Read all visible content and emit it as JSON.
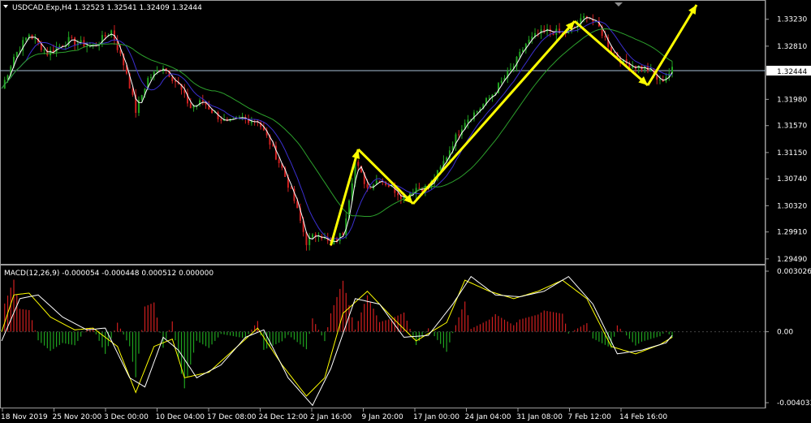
{
  "header": {
    "symbol_line": "USDCAD.Exp,H4  1.32523 1.32541 1.32409 1.32444",
    "dropdown_icon": "triangle-down-icon"
  },
  "colors": {
    "background": "#000000",
    "bull_candle": "#1fa31f",
    "bear_candle": "#d01f1f",
    "fast_ma": "#ffffff",
    "mid_ma": "#3b2fd0",
    "slow_ma": "#2ca02c",
    "arrows": "#ffff00",
    "macd_signal": "#ffff00",
    "macd_line": "#ffffff",
    "price_line": "#a9c1d6"
  },
  "chart_data": [
    {
      "type": "candlestick",
      "panel": "price",
      "title": "USDCAD.Exp,H4  1.32523 1.32541 1.32409 1.32444",
      "y_axis_ticks": [
        "1.33230",
        "1.32810",
        "1.32444",
        "1.31980",
        "1.31570",
        "1.31150",
        "1.30740",
        "1.30320",
        "1.29910",
        "1.29490"
      ],
      "ylim": [
        1.2945,
        1.3348
      ],
      "current_price": "1.32444",
      "x_axis_ticks": [
        "18 Nov 2019",
        "25 Nov 20:00",
        "3 Dec 00:00",
        "10 Dec 04:00",
        "17 Dec 08:00",
        "24 Dec 12:00",
        "2 Jan 16:00",
        "9 Jan 20:00",
        "17 Jan 00:00",
        "24 Jan 04:00",
        "31 Jan 08:00",
        "7 Feb 12:00",
        "14 Feb 16:00"
      ],
      "close_path": [
        [
          0,
          1.3215
        ],
        [
          4,
          1.3265
        ],
        [
          9,
          1.33
        ],
        [
          15,
          1.327
        ],
        [
          22,
          1.329
        ],
        [
          30,
          1.328
        ],
        [
          36,
          1.3305
        ],
        [
          41,
          1.324
        ],
        [
          44,
          1.318
        ],
        [
          48,
          1.323
        ],
        [
          53,
          1.325
        ],
        [
          58,
          1.322
        ],
        [
          62,
          1.3185
        ],
        [
          66,
          1.3195
        ],
        [
          70,
          1.3175
        ],
        [
          74,
          1.316
        ],
        [
          79,
          1.3168
        ],
        [
          84,
          1.3165
        ],
        [
          88,
          1.313
        ],
        [
          92,
          1.309
        ],
        [
          96,
          1.304
        ],
        [
          100,
          1.2975
        ],
        [
          104,
          1.299
        ],
        [
          108,
          1.297
        ],
        [
          112,
          1.299
        ],
        [
          116,
          1.31
        ],
        [
          120,
          1.306
        ],
        [
          124,
          1.3075
        ],
        [
          128,
          1.306
        ],
        [
          132,
          1.3045
        ],
        [
          136,
          1.306
        ],
        [
          140,
          1.306
        ],
        [
          144,
          1.309
        ],
        [
          148,
          1.313
        ],
        [
          152,
          1.3165
        ],
        [
          156,
          1.318
        ],
        [
          160,
          1.32
        ],
        [
          164,
          1.3225
        ],
        [
          168,
          1.325
        ],
        [
          172,
          1.3285
        ],
        [
          176,
          1.33
        ],
        [
          180,
          1.3305
        ],
        [
          184,
          1.33
        ],
        [
          188,
          1.331
        ],
        [
          192,
          1.333
        ],
        [
          196,
          1.331
        ],
        [
          200,
          1.3275
        ],
        [
          204,
          1.3255
        ],
        [
          208,
          1.325
        ],
        [
          212,
          1.3245
        ],
        [
          216,
          1.3225
        ],
        [
          220,
          1.3244
        ]
      ],
      "moving_averages": [
        "fast",
        "mid",
        "slow"
      ],
      "annotations": {
        "type": "zigzag-arrows",
        "points": [
          [
            108,
            1.297
          ],
          [
            117,
            1.312
          ],
          [
            135,
            1.3035
          ],
          [
            188,
            1.332
          ],
          [
            212,
            1.322
          ],
          [
            228,
            1.335
          ]
        ]
      }
    },
    {
      "type": "histogram+lines",
      "panel": "macd",
      "title": "MACD(12,26,9) -0.000054 -0.000448 0.000512 0.000000",
      "y_axis_ticks": [
        "0.003026",
        "0.00",
        "-0.004033"
      ],
      "ylim": [
        -0.004033,
        0.003026
      ],
      "series": [
        {
          "name": "MACD",
          "color": "macd_signal",
          "values": [
            [
              0,
              0
            ],
            [
              4,
              0.002
            ],
            [
              9,
              0.0021
            ],
            [
              16,
              0.0008
            ],
            [
              24,
              0.0001
            ],
            [
              30,
              0.0002
            ],
            [
              38,
              -0.0008
            ],
            [
              44,
              -0.0033
            ],
            [
              50,
              -0.0008
            ],
            [
              56,
              -0.0004
            ],
            [
              60,
              -0.0025
            ],
            [
              68,
              -0.0022
            ],
            [
              76,
              -0.001
            ],
            [
              84,
              0.0002
            ],
            [
              92,
              -0.0018
            ],
            [
              100,
              -0.0035
            ],
            [
              106,
              -0.0025
            ],
            [
              112,
              0.001
            ],
            [
              120,
              0.0022
            ],
            [
              128,
              0.0008
            ],
            [
              136,
              -0.0005
            ],
            [
              146,
              0.0005
            ],
            [
              152,
              0.0028
            ],
            [
              160,
              0.0022
            ],
            [
              168,
              0.0018
            ],
            [
              176,
              0.0022
            ],
            [
              184,
              0.0028
            ],
            [
              192,
              0.0018
            ],
            [
              200,
              -0.0008
            ],
            [
              208,
              -0.0012
            ],
            [
              216,
              -0.0007
            ],
            [
              220,
              -0.0003
            ]
          ]
        },
        {
          "name": "Signal",
          "color": "macd_line",
          "values": [
            [
              0,
              -0.0005
            ],
            [
              6,
              0.0018
            ],
            [
              12,
              0.002
            ],
            [
              20,
              0.0008
            ],
            [
              28,
              0.0001
            ],
            [
              34,
              0.0002
            ],
            [
              42,
              -0.0025
            ],
            [
              47,
              -0.003
            ],
            [
              53,
              -0.0003
            ],
            [
              58,
              -0.001
            ],
            [
              64,
              -0.0025
            ],
            [
              72,
              -0.0018
            ],
            [
              80,
              -0.0003
            ],
            [
              86,
              0.0001
            ],
            [
              94,
              -0.0025
            ],
            [
              102,
              -0.004
            ],
            [
              108,
              -0.002
            ],
            [
              116,
              0.0018
            ],
            [
              124,
              0.0015
            ],
            [
              132,
              -0.0003
            ],
            [
              140,
              -0.0002
            ],
            [
              148,
              0.0015
            ],
            [
              154,
              0.003
            ],
            [
              162,
              0.002
            ],
            [
              170,
              0.0019
            ],
            [
              178,
              0.0022
            ],
            [
              186,
              0.003
            ],
            [
              194,
              0.0015
            ],
            [
              202,
              -0.0012
            ],
            [
              210,
              -0.001
            ],
            [
              218,
              -0.0006
            ],
            [
              220,
              -0.0002
            ]
          ]
        }
      ]
    }
  ]
}
